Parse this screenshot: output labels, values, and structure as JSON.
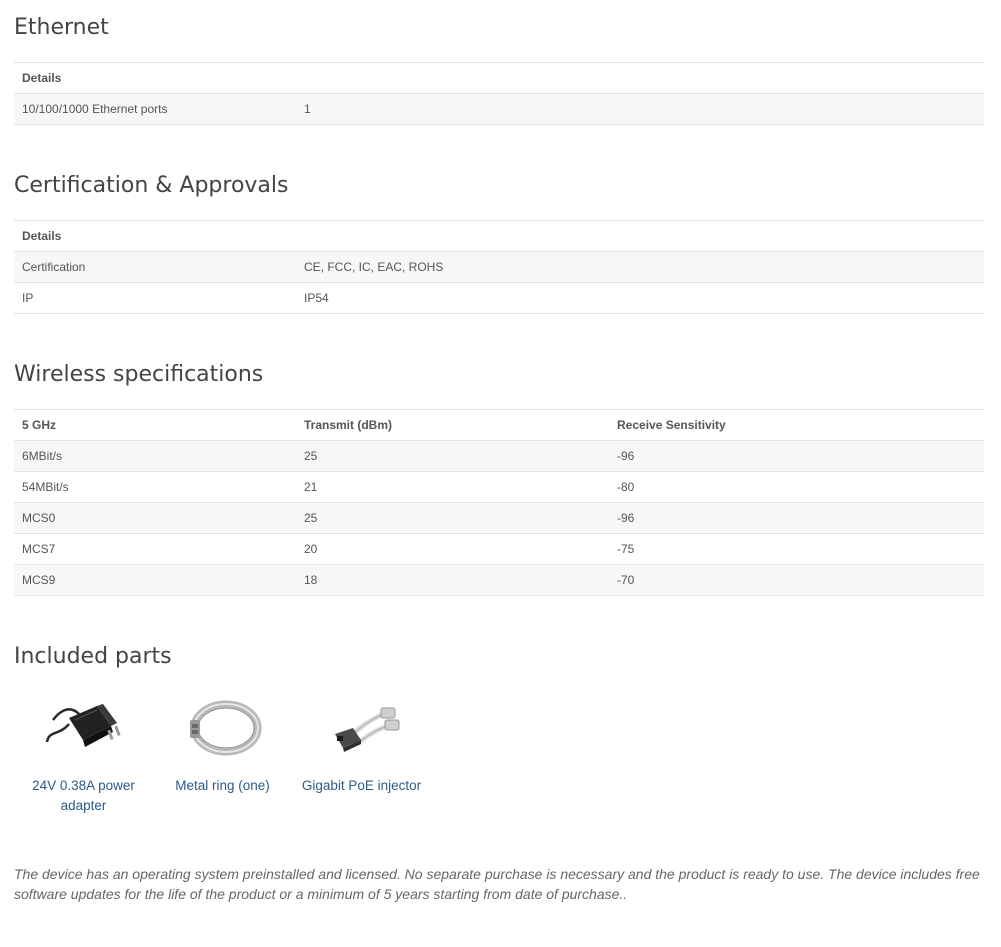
{
  "ethernet": {
    "title": "Ethernet",
    "header": "Details",
    "rows": [
      {
        "label": "10/100/1000 Ethernet ports",
        "value": "1"
      }
    ]
  },
  "certification": {
    "title": "Certification & Approvals",
    "header": "Details",
    "rows": [
      {
        "label": "Certification",
        "value": "CE, FCC, IC, EAC, ROHS"
      },
      {
        "label": "IP",
        "value": "IP54"
      }
    ]
  },
  "wireless": {
    "title": "Wireless specifications",
    "headers": [
      "5 GHz",
      "Transmit (dBm)",
      "Receive Sensitivity"
    ],
    "rows": [
      [
        "6MBit/s",
        "25",
        "-96"
      ],
      [
        "54MBit/s",
        "21",
        "-80"
      ],
      [
        "MCS0",
        "25",
        "-96"
      ],
      [
        "MCS7",
        "20",
        "-75"
      ],
      [
        "MCS9",
        "18",
        "-70"
      ]
    ]
  },
  "parts": {
    "title": "Included parts",
    "items": [
      {
        "label": "24V 0.38A power adapter",
        "icon": "power-adapter-icon"
      },
      {
        "label": "Metal ring (one)",
        "icon": "metal-ring-icon"
      },
      {
        "label": "Gigabit PoE injector",
        "icon": "poe-injector-icon"
      }
    ]
  },
  "note": "The device has an operating system preinstalled and licensed. No separate purchase is necessary and the product is ready to use. The device includes free software updates for the life of the product or a minimum of 5 years starting from date of purchase..",
  "colors": {
    "link": "#2e5a86",
    "row_alt": "#f7f7f7",
    "border": "#e4e4e4"
  }
}
